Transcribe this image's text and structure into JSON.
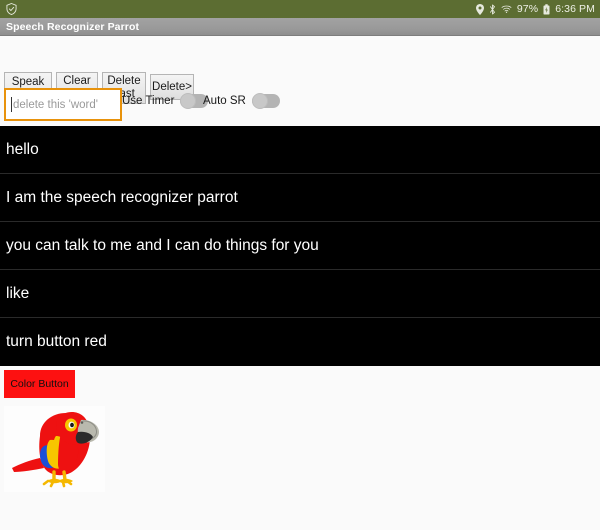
{
  "status_bar": {
    "left_icons": [
      {
        "name": "shield-check-icon",
        "glyph": "shield"
      }
    ],
    "right_icons": [
      {
        "name": "location-icon",
        "glyph": "pin"
      },
      {
        "name": "bluetooth-icon",
        "glyph": "bluetooth"
      },
      {
        "name": "wifi-icon",
        "glyph": "wifi"
      }
    ],
    "battery_percent": "97%",
    "battery_icon": "battery-icon",
    "time": "6:36 PM",
    "background_color": "#5c6d32"
  },
  "title_bar": {
    "title": "Speech Recognizer Parrot",
    "background_color": "#9a9a9a"
  },
  "toolbar": {
    "speak_label": "Speak\nanother\nword",
    "clear_label": "Clear\nALL",
    "delete_last_label": "Delete\nLast",
    "delete_label": "Delete>"
  },
  "input_row": {
    "word_input": {
      "value": "",
      "placeholder": "delete this 'word'",
      "focus_color": "#e8920b"
    },
    "switches": [
      {
        "label": "Use Timer",
        "state": "off"
      },
      {
        "label": "Auto SR",
        "state": "off"
      }
    ]
  },
  "recognized_list": {
    "background_color": "#000000",
    "items": [
      "hello",
      "I am the speech recognizer parrot",
      "you can talk to me and I can do things for you",
      "like",
      "turn button red"
    ]
  },
  "color_button": {
    "label": "Color Button",
    "background_color": "#fd1111",
    "text_color": "#111111"
  },
  "parrot_image": {
    "alt": "cartoon scarlet macaw parrot",
    "colors": {
      "body": "#ee1111",
      "wing_yellow": "#f7c600",
      "wing_blue": "#1b4fd8",
      "beak": "#b9b9ae",
      "beak_dark": "#2b2b2b",
      "feet": "#f5b800",
      "eye_ring": "#f7c600"
    }
  }
}
